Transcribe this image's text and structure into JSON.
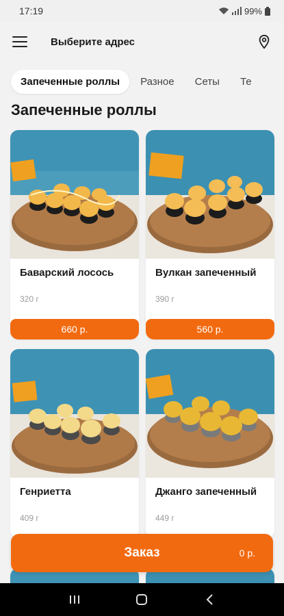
{
  "status_bar": {
    "time": "17:19",
    "battery": "99%"
  },
  "header": {
    "address_label": "Выберите адрес"
  },
  "tabs": [
    {
      "label": "Запеченные роллы",
      "active": true
    },
    {
      "label": "Разное",
      "active": false
    },
    {
      "label": "Сеты",
      "active": false
    },
    {
      "label": "Те",
      "active": false
    }
  ],
  "section_title": "Запеченные роллы",
  "products": [
    {
      "name": "Баварский лосось",
      "weight": "320 г",
      "price": "660 р."
    },
    {
      "name": "Вулкан запеченный",
      "weight": "390 г",
      "price": "560 р."
    },
    {
      "name": "Генриетта",
      "weight": "409 г",
      "price": ""
    },
    {
      "name": "Джанго запеченный",
      "weight": "449 г",
      "price": ""
    }
  ],
  "order": {
    "label": "Заказ",
    "sum": "0 р."
  },
  "colors": {
    "accent": "#f26a10",
    "background": "#f2f2f2"
  },
  "icons": {
    "menu": "menu-icon",
    "location": "location-pin-icon",
    "wifi": "wifi-icon",
    "signal": "signal-icon",
    "battery": "battery-icon",
    "nav_recent": "recent-apps-icon",
    "nav_home": "home-icon",
    "nav_back": "back-icon"
  }
}
